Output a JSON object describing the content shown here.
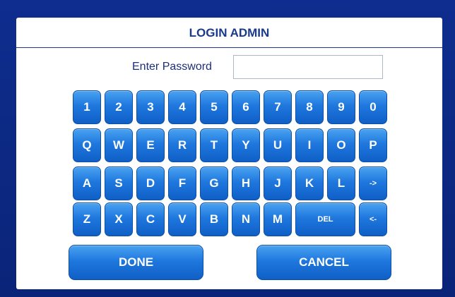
{
  "dialog": {
    "title": "LOGIN ADMIN",
    "password_label": "Enter Password",
    "password_value": ""
  },
  "keyboard": {
    "rows": [
      [
        "1",
        "2",
        "3",
        "4",
        "5",
        "6",
        "7",
        "8",
        "9",
        "0"
      ],
      [
        "Q",
        "W",
        "E",
        "R",
        "T",
        "Y",
        "U",
        "I",
        "O",
        "P"
      ],
      [
        "A",
        "S",
        "D",
        "F",
        "G",
        "H",
        "J",
        "K",
        "L",
        "->"
      ],
      [
        "Z",
        "X",
        "C",
        "V",
        "B",
        "N",
        "M",
        "DEL",
        "<-"
      ]
    ]
  },
  "actions": {
    "done_label": "DONE",
    "cancel_label": "CANCEL"
  },
  "colors": {
    "frame": "#0d2a85",
    "title": "#1b3a8c",
    "key_top": "#4aa2f0",
    "key_bottom": "#0f5fc6"
  }
}
